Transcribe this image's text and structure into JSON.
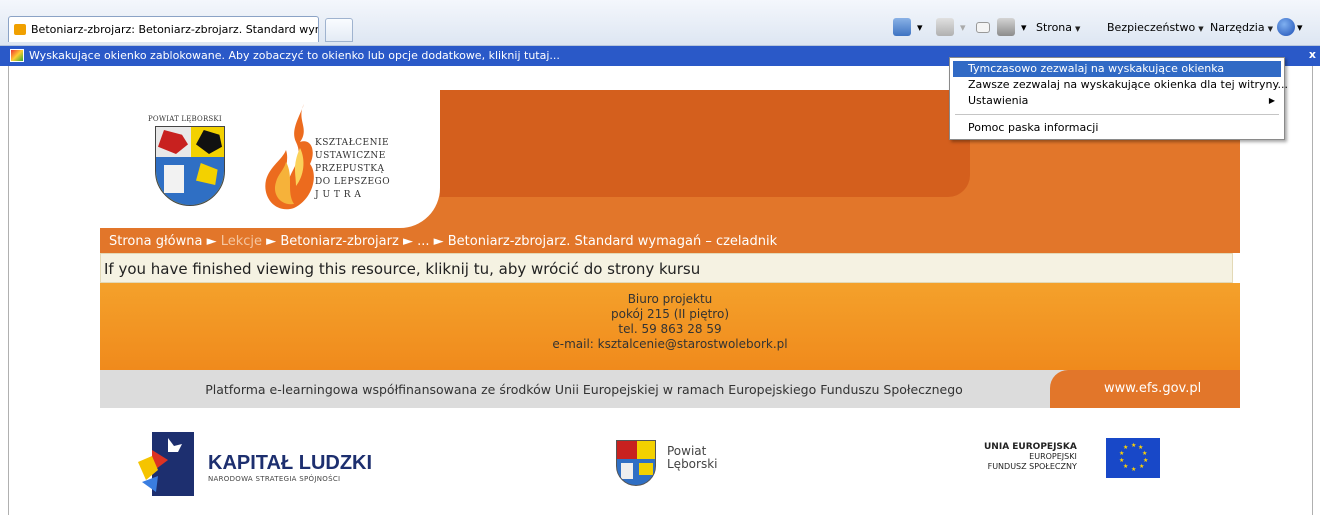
{
  "browser": {
    "tab_title": "Betoniarz-zbrojarz: Betoniarz-zbrojarz. Standard wym...",
    "commands": {
      "strona": "Strona",
      "bezpieczenstwo": "Bezpieczeństwo",
      "narzedzia": "Narzędzia"
    },
    "infobar_text": "Wyskakujące okienko zablokowane. Aby zobaczyć to okienko lub opcje dodatkowe, kliknij tutaj...",
    "infobar_close": "x"
  },
  "popup_menu": {
    "items": [
      "Tymczasowo zezwalaj na wyskakujące okienka",
      "Zawsze zezwalaj na wyskakujące okienka dla tej witryny...",
      "Ustawienia",
      "Pomoc paska informacji"
    ],
    "submenu_arrow": "▶"
  },
  "header": {
    "powiat_caption": "POWIAT LĘBORSKI",
    "tagline": [
      "KSZTAŁCENIE",
      "USTAWICZNE",
      "PRZEPUSTKĄ",
      "DO LEPSZEGO",
      "J U T R A"
    ]
  },
  "breadcrumb": {
    "home": "Strona główna",
    "lessons": "Lekcje",
    "course": "Betoniarz-zbrojarz",
    "ellipsis": "...",
    "current": "Betoniarz-zbrojarz. Standard wymagań – czeladnik",
    "sep": "►"
  },
  "notice": "If you have finished viewing this resource, kliknij tu, aby wrócić do strony kursu",
  "biuro": {
    "title": "Biuro projektu",
    "room": "pokój 215 (II piętro)",
    "phone": "tel. 59 863 28 59",
    "email": "e-mail: ksztalcenie@starostwolebork.pl"
  },
  "efs": {
    "text": "Platforma e-learningowa współfinansowana ze środków Unii Europejskiej w ramach Europejskiego Funduszu Społecznego",
    "link": "www.efs.gov.pl"
  },
  "footer": {
    "kl_title": "KAPITAŁ LUDZKI",
    "kl_sub": "NARODOWA STRATEGIA SPÓJNOŚCI",
    "powiat_line1": "Powiat",
    "powiat_line2": "Lęborski",
    "ue_line1": "UNIA EUROPEJSKA",
    "ue_line2": "EUROPEJSKI",
    "ue_line3": "FUNDUSZ SPOŁECZNY"
  }
}
